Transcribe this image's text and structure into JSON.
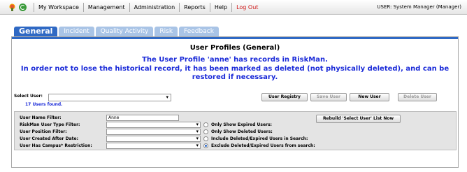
{
  "topbar": {
    "menu": [
      "My Workspace",
      "Management",
      "Administration",
      "Reports",
      "Help",
      "Log Out"
    ],
    "user": "USER: System Manager (Manager)"
  },
  "tabs": [
    "General",
    "Incident",
    "Quality Activity",
    "Risk",
    "Feedback"
  ],
  "page": {
    "title": "User Profiles (General)",
    "message_line1": "The User Profile 'anne' has records in RiskMan.",
    "message_line2": "In order not to lose the historical record, it has been marked as deleted (not physically deleted), and can be restored if necessary."
  },
  "select_user": {
    "label": "Select User:",
    "value": "",
    "count": "17 Users found."
  },
  "buttons": {
    "registry": "User Registry",
    "save": "Save User",
    "new": "New User",
    "delete": "Delete User",
    "rebuild": "Rebuild 'Select User' List Now"
  },
  "filters": {
    "name_label": "User Name Filter:",
    "name_value": "Anne",
    "type_label": "RiskMan User Type Filter:",
    "position_label": "User Position Filter:",
    "created_label": "User Created After Date:",
    "campus_label": "User Has Campus* Restriction:"
  },
  "options": {
    "expired": "Only Show Expired Users:",
    "deleted": "Only Show Deleted Users:",
    "include": "Include Deleted/Expired Users in Search:",
    "exclude": "Exclude Deleted/Expired Users from search:",
    "selected": "exclude"
  }
}
